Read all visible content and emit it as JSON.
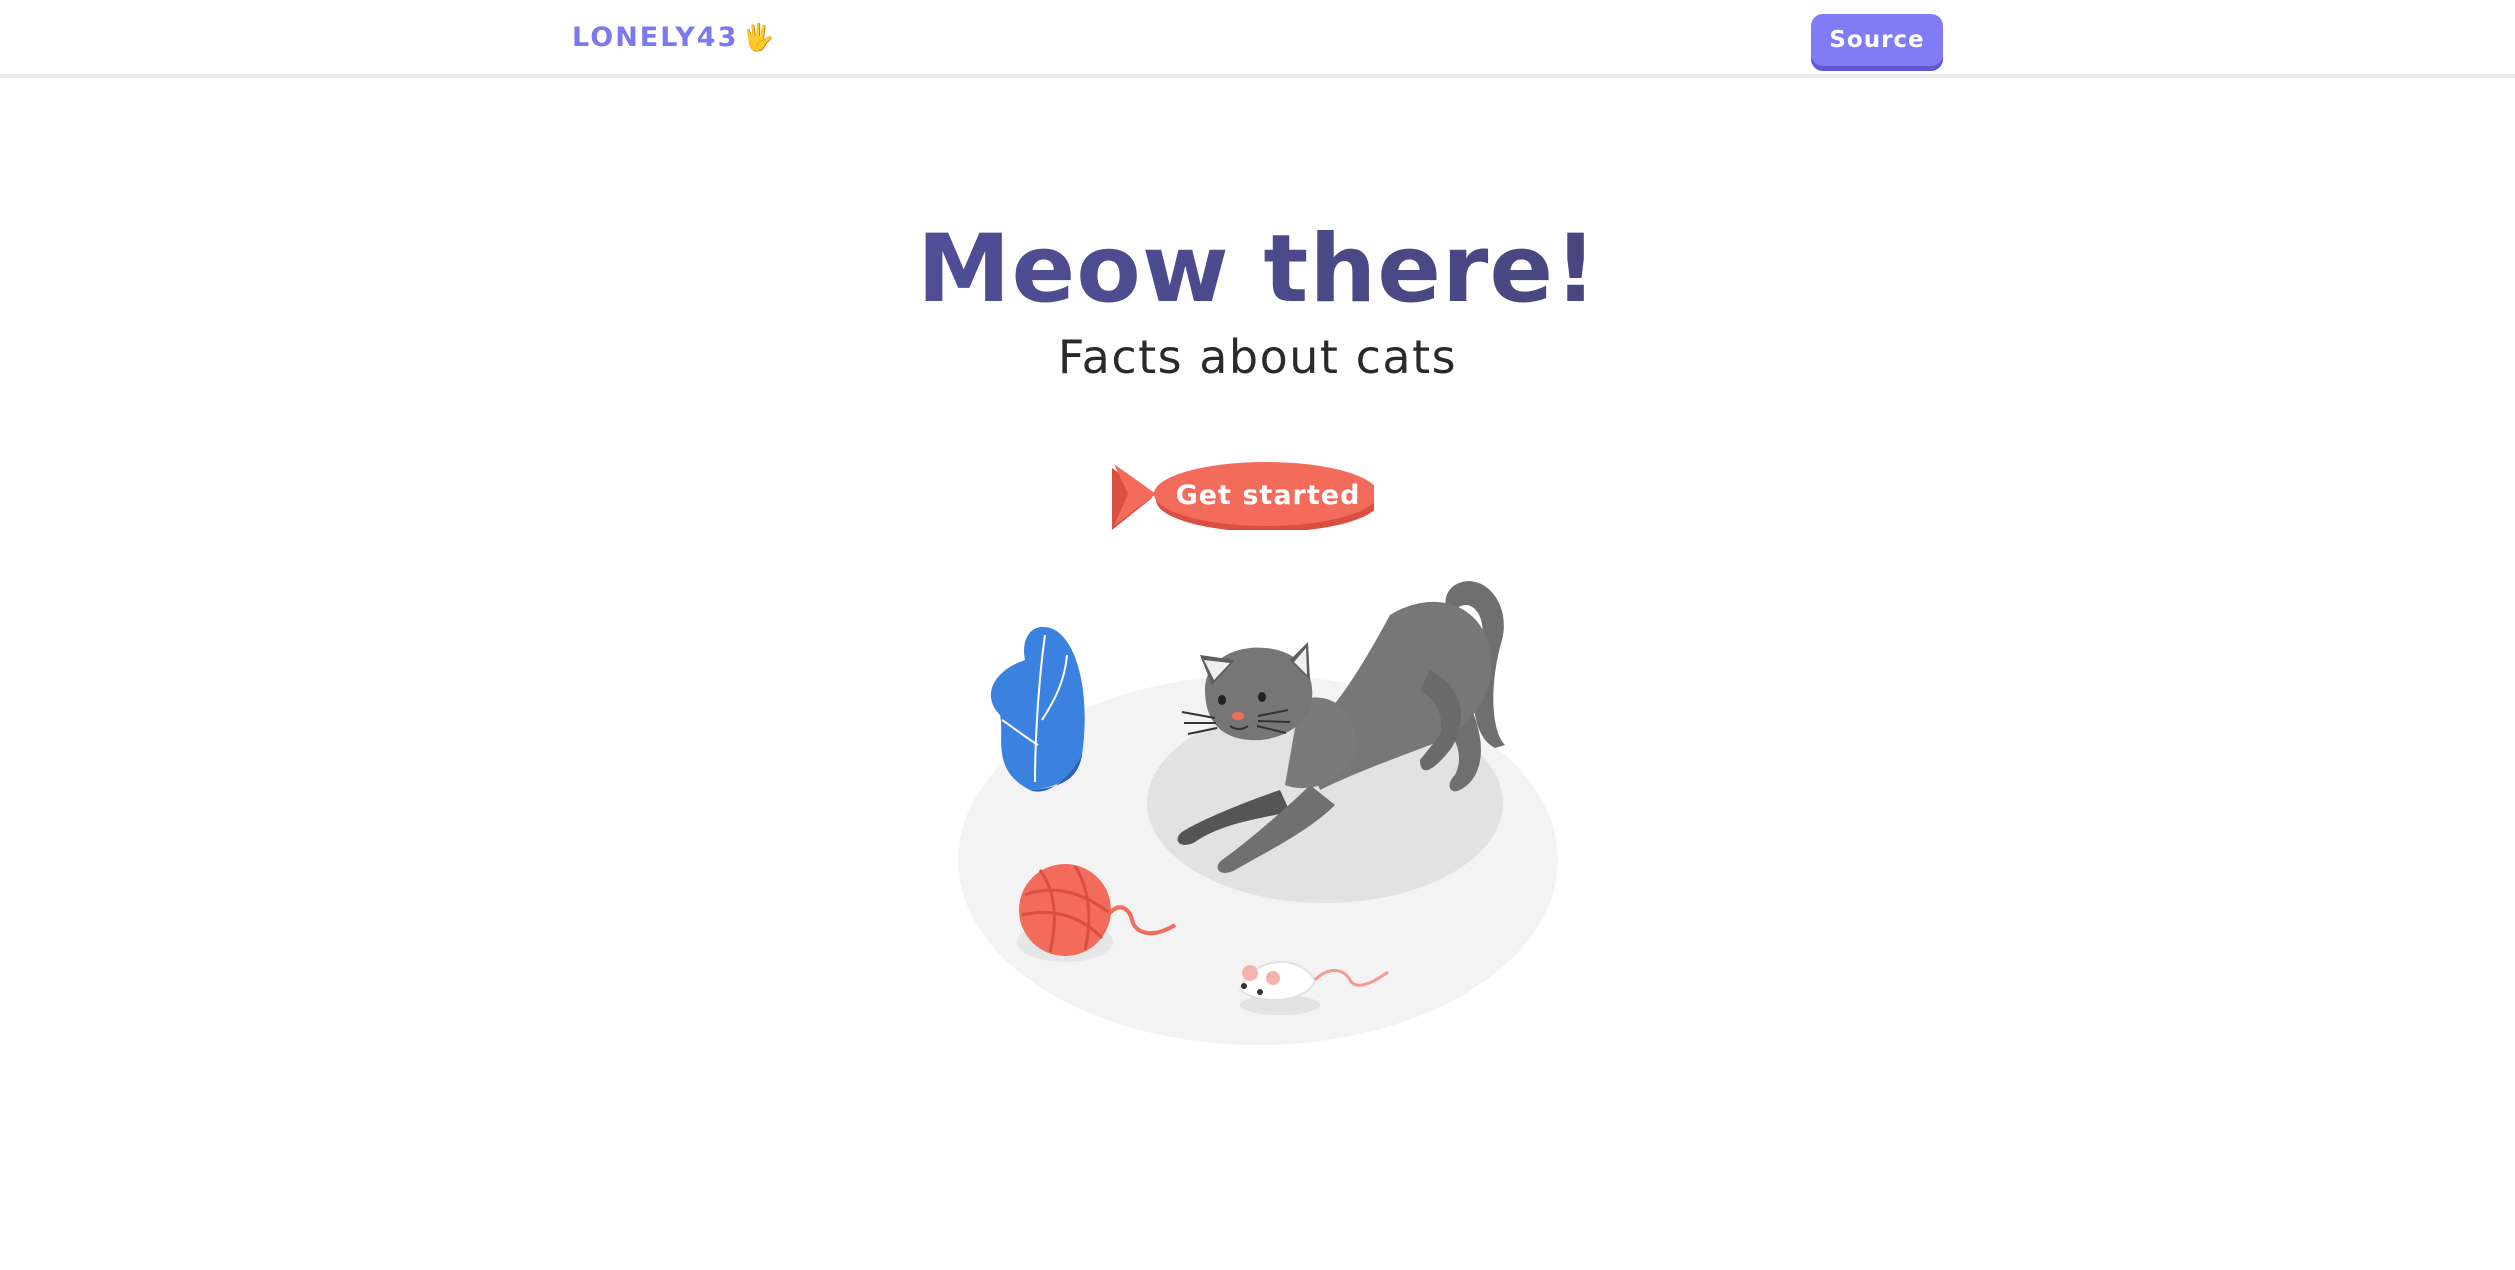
{
  "navbar": {
    "brand": "LONELY43",
    "brand_emoji": "🖐",
    "source_label": "Source"
  },
  "hero": {
    "title": "Meow there!",
    "subtitle": "Facts about cats",
    "cta_label": "Get started"
  },
  "colors": {
    "brand": "#7b78f0",
    "button": "#7f7cf6",
    "cta": "#f26b5b",
    "cat": "#6f6f6f"
  }
}
